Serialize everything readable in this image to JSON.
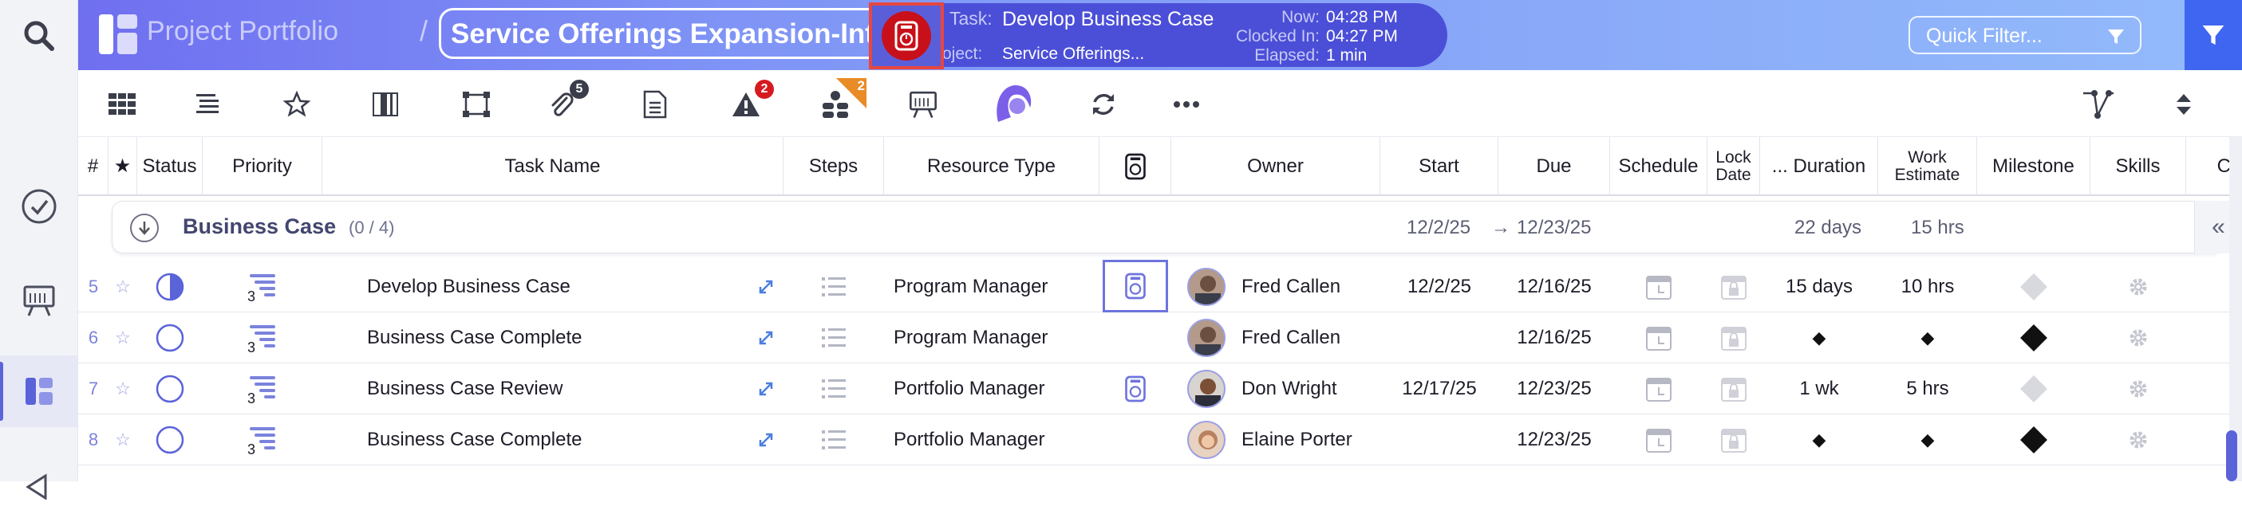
{
  "app": {
    "title": "Project Portfolio",
    "breadcrumb_separator": "/",
    "project_name": "Service Offerings Expansion-Int"
  },
  "timer": {
    "task_label": "Task:",
    "task_value": "Develop Business Case",
    "project_label": "Project:",
    "project_value": "Service Offerings...",
    "now_label": "Now:",
    "now_value": "04:28 PM",
    "clocked_label": "Clocked In:",
    "clocked_value": "04:27 PM",
    "elapsed_label": "Elapsed:",
    "elapsed_value": "1 min"
  },
  "quick_filter": {
    "label": "Quick Filter..."
  },
  "toolbar": {
    "attachments_count": "5",
    "issues_count": "2",
    "resources_count": "2"
  },
  "columns": {
    "num": "#",
    "star": "★",
    "status": "Status",
    "priority": "Priority",
    "task_name": "Task Name",
    "steps": "Steps",
    "resource_type": "Resource Type",
    "owner": "Owner",
    "start": "Start",
    "due": "Due",
    "schedule": "Schedule",
    "lock_date": "Lock Date",
    "duration": "... Duration",
    "work_estimate": "Work Estimate",
    "milestone": "Milestone",
    "skills": "Skills",
    "cut": "C"
  },
  "group": {
    "name": "Business Case",
    "count": "(0 / 4)",
    "start": "12/2/25",
    "arrow": "→",
    "due": "12/23/25",
    "duration": "22 days",
    "work": "15 hrs",
    "collapse_label": "«"
  },
  "rows": [
    {
      "num": "5",
      "priority_level": "3",
      "status": "half",
      "task": "Develop Business Case",
      "resource": "Program Manager",
      "timer_icon": "highlighted",
      "owner": "Fred  Callen",
      "start": "12/2/25",
      "due": "12/16/25",
      "duration": "15 days",
      "work": "10 hrs",
      "milestone": "grey"
    },
    {
      "num": "6",
      "priority_level": "3",
      "status": "empty",
      "task": "Business Case Complete",
      "resource": "Program Manager",
      "timer_icon": "none",
      "owner": "Fred  Callen",
      "start": "",
      "due": "12/16/25",
      "duration": "◆",
      "work": "◆",
      "milestone": "black"
    },
    {
      "num": "7",
      "priority_level": "3",
      "status": "empty",
      "task": "Business Case Review",
      "resource": "Portfolio Manager",
      "timer_icon": "plain",
      "owner": "Don Wright",
      "start": "12/17/25",
      "due": "12/23/25",
      "duration": "1 wk",
      "work": "5 hrs",
      "milestone": "grey"
    },
    {
      "num": "8",
      "priority_level": "3",
      "status": "empty",
      "task": "Business Case Complete",
      "resource": "Portfolio Manager",
      "timer_icon": "none",
      "owner": "Elaine Porter",
      "start": "",
      "due": "12/23/25",
      "duration": "◆",
      "work": "◆",
      "milestone": "black"
    }
  ],
  "icons": [
    "search-icon",
    "check-circle-icon",
    "presentation-icon",
    "portfolio-icon",
    "megaphone-icon",
    "grid-icon",
    "list-icon",
    "star-icon",
    "columns-icon",
    "select-icon",
    "paperclip-icon",
    "document-icon",
    "warning-icon",
    "resources-icon",
    "board-icon",
    "avatar-icon",
    "refresh-icon",
    "more-icon",
    "flow-icon",
    "sort-icon",
    "filter-icon",
    "clock-icon"
  ],
  "colors": {
    "accent": "#5b63d9",
    "timer_red": "#c8101a",
    "focus_red": "#e8463f",
    "header_start": "#6f6ff0",
    "header_end": "#93bbfb"
  }
}
